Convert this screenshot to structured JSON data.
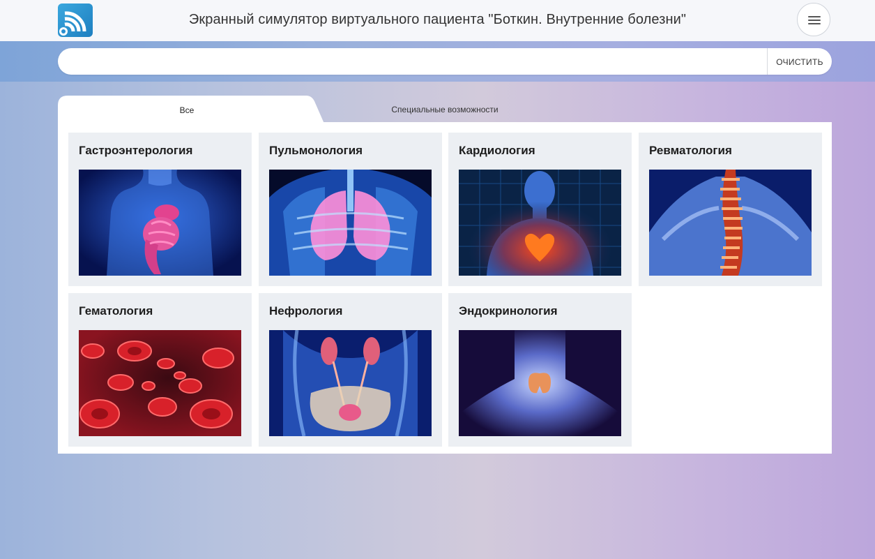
{
  "header": {
    "title": "Экранный симулятор виртуального пациента \"Боткин. Внутренние болезни\""
  },
  "search": {
    "value": "",
    "placeholder": "",
    "clear_label": "ОЧИСТИТЬ"
  },
  "tabs": [
    {
      "label": "Все",
      "active": true
    },
    {
      "label": "Специальные возможности",
      "active": false
    }
  ],
  "cards": [
    {
      "title": "Гастроэнтерология",
      "image": "digestive-system-image"
    },
    {
      "title": "Пульмонология",
      "image": "lungs-image"
    },
    {
      "title": "Кардиология",
      "image": "heart-image"
    },
    {
      "title": "Ревматология",
      "image": "spine-image"
    },
    {
      "title": "Гематология",
      "image": "blood-cells-image"
    },
    {
      "title": "Нефрология",
      "image": "kidneys-image"
    },
    {
      "title": "Эндокринология",
      "image": "thyroid-image"
    }
  ],
  "colors": {
    "accent": "#2a93d5",
    "card_bg": "#eceff3",
    "header_bg": "#f6f7fa"
  }
}
